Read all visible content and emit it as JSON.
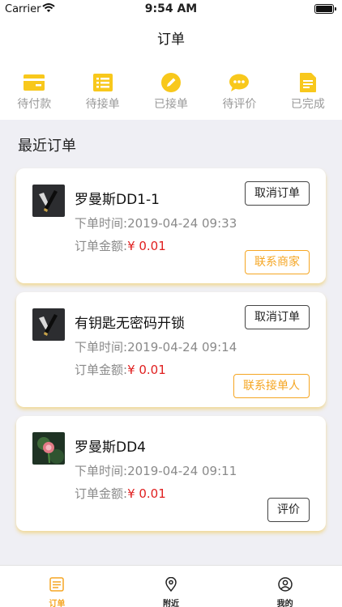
{
  "status_bar": {
    "carrier": "Carrier",
    "time": "9:54 AM"
  },
  "navbar": {
    "title": "订单"
  },
  "status_tabs": [
    {
      "label": "待付款",
      "icon": "wallet-icon"
    },
    {
      "label": "待接单",
      "icon": "list-icon"
    },
    {
      "label": "已接单",
      "icon": "pencil-icon"
    },
    {
      "label": "待评价",
      "icon": "chat-bubble-icon"
    },
    {
      "label": "已完成",
      "icon": "document-icon"
    }
  ],
  "section_title": "最近订单",
  "orders": [
    {
      "name": "罗曼斯DD1-1",
      "time_label": "下单时间:",
      "time": "2019-04-24 09:33",
      "amount_label": "订单金额:",
      "amount": "¥ 0.01",
      "primary_button": "取消订单",
      "secondary_button": "联系商家"
    },
    {
      "name": "有钥匙无密码开锁",
      "time_label": "下单时间:",
      "time": "2019-04-24 09:14",
      "amount_label": "订单金额:",
      "amount": "¥ 0.01",
      "primary_button": "取消订单",
      "secondary_button": "联系接单人"
    },
    {
      "name": "罗曼斯DD4",
      "time_label": "下单时间:",
      "time": "2019-04-24 09:11",
      "amount_label": "订单金额:",
      "amount": "¥ 0.01",
      "secondary_button": "评价"
    }
  ],
  "tab_bar": [
    {
      "label": "订单",
      "icon": "order-list-icon",
      "active": true
    },
    {
      "label": "附近",
      "icon": "location-pin-icon",
      "active": false
    },
    {
      "label": "我的",
      "icon": "user-profile-icon",
      "active": false
    }
  ],
  "colors": {
    "accent": "#f5a623",
    "icon_yellow": "#f8c81c",
    "price": "#e02020",
    "background": "#efeff4"
  }
}
